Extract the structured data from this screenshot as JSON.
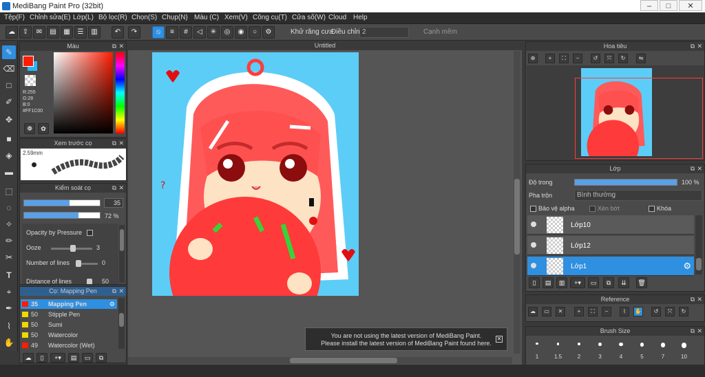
{
  "window": {
    "title": "MediBang Paint Pro (32bit)",
    "min": "–",
    "max": "□",
    "close": "✕"
  },
  "menu": [
    "Tệp(F)",
    "Chỉnh sửa(E)",
    "Lớp(L)",
    "Bộ lọc(R)",
    "Chọn(S)",
    "Chụp(N)",
    "Màu (C)",
    "Xem(V)",
    "Công cụ(T)",
    "Cửa số(W)",
    "Cloud",
    "Help"
  ],
  "toolbar": {
    "antialias_label": "Khử răng cưa",
    "adjust_label": "Điều chỉnh",
    "adjust_value": "2",
    "sharp_label": "Cạnh mềm"
  },
  "color_panel": {
    "title": "Màu",
    "r": "R:255",
    "g": "G:28",
    "b": "B:0",
    "hex": "#FF1C00",
    "fg_color": "#ff1c00",
    "bg_color": "#29b6f6"
  },
  "brush_preview": {
    "title": "Xem trước cọ",
    "size": "2.59mm"
  },
  "brush_control": {
    "title": "Kiểm soát cọ",
    "size_value": "35",
    "opacity_value": "72 %",
    "size_fraction": 0.6,
    "opacity_fraction": 0.72,
    "opacity_by_pressure": "Opacity by Pressure",
    "ooze": "Ooze",
    "ooze_value": "3",
    "lines": "Number of lines",
    "lines_value": "0",
    "distance": "Distance of lines",
    "distance_value": "50"
  },
  "brush_list": {
    "title": "Cọ: Mapping Pen",
    "items": [
      {
        "size": "35",
        "name": "Mapping Pen",
        "color": "#ff1c00",
        "selected": true
      },
      {
        "size": "50",
        "name": "Stipple Pen",
        "color": "#f0d800",
        "selected": false
      },
      {
        "size": "50",
        "name": "Sumi",
        "color": "#f0d800",
        "selected": false
      },
      {
        "size": "50",
        "name": "Watercolor",
        "color": "#f0d800",
        "selected": false
      },
      {
        "size": "49",
        "name": "Watercolor (Wet)",
        "color": "#ff1c00",
        "selected": false
      }
    ]
  },
  "canvas": {
    "tab": "Untitled"
  },
  "notice": {
    "line1": "You are not using the latest version of MediBang Paint.",
    "line2": "Please install the latest version of MediBang Paint found here."
  },
  "navigator": {
    "title": "Hoa tiêu"
  },
  "layers": {
    "title": "Lớp",
    "opacity_label": "Độ trong",
    "opacity_value": "100 %",
    "opacity_fraction": 1.0,
    "blend_label": "Pha trộn",
    "blend_value": "Bình thường",
    "protect_alpha": "Bảo vệ alpha",
    "clipping": "Xén bớt",
    "lock": "Khóa",
    "items": [
      {
        "name": "Lớp10",
        "selected": false
      },
      {
        "name": "Lớp12",
        "selected": false
      },
      {
        "name": "Lớp1",
        "selected": true
      }
    ]
  },
  "reference": {
    "title": "Reference"
  },
  "brush_size": {
    "title": "Brush Size",
    "sizes": [
      "1",
      "1.5",
      "2",
      "3",
      "4",
      "5",
      "7",
      "10"
    ]
  }
}
